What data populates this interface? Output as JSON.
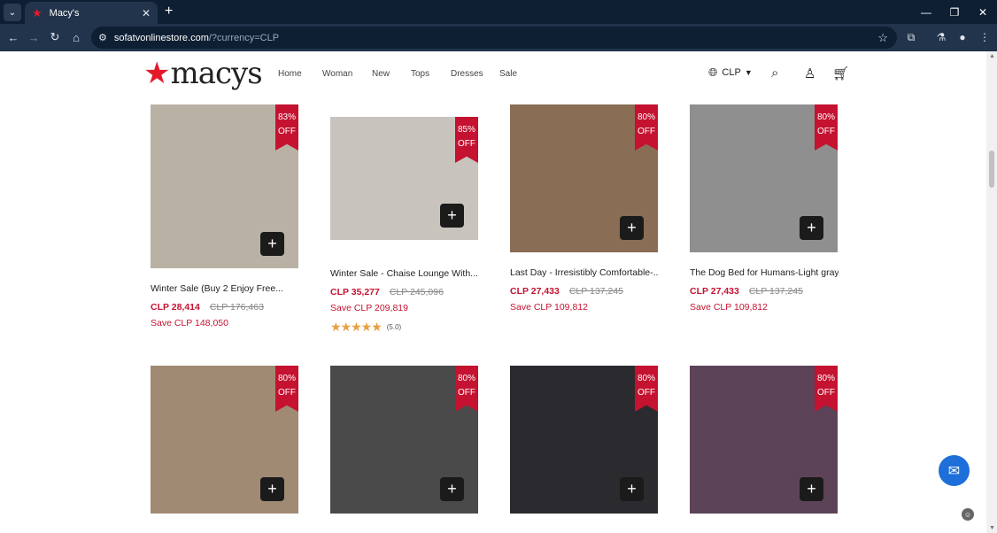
{
  "browser": {
    "tab_title": "Macy's",
    "url_host": "sofatvonlinestore.com",
    "url_path": "/?currency=CLP"
  },
  "header": {
    "logo_text": "macys",
    "nav": [
      "Home",
      "Woman",
      "New",
      "Tops",
      "Dresses",
      "Sale"
    ],
    "currency": "CLP"
  },
  "products": [
    {
      "discount": "83%",
      "off": "OFF",
      "name": "Winter Sale (Buy 2 Enjoy Free...",
      "price": "CLP 28,414",
      "original": "CLP 176,463",
      "save": "Save CLP 148,050",
      "color": "#b9b1a4"
    },
    {
      "discount": "85%",
      "off": "OFF",
      "name": "Winter Sale - Chaise Lounge With...",
      "price": "CLP 35,277",
      "original": "CLP 245,096",
      "save": "Save CLP 209,819",
      "rating": "(5.0)",
      "color": "#c8c4bd"
    },
    {
      "discount": "80%",
      "off": "OFF",
      "name": "Last Day - Irresistibly Comfortable-...",
      "price": "CLP 27,433",
      "original": "CLP 137,245",
      "save": "Save CLP 109,812",
      "color": "#8a6d55"
    },
    {
      "discount": "80%",
      "off": "OFF",
      "name": "The Dog Bed for Humans-Light gray",
      "price": "CLP 27,433",
      "original": "CLP 137,245",
      "save": "Save CLP 109,812",
      "color": "#8f8f8f"
    },
    {
      "discount": "80%",
      "off": "OFF",
      "color": "#a08a73"
    },
    {
      "discount": "80%",
      "off": "OFF",
      "color": "#4a4a4a"
    },
    {
      "discount": "80%",
      "off": "OFF",
      "color": "#2a2a2f"
    },
    {
      "discount": "80%",
      "off": "OFF",
      "color": "#5d4358"
    }
  ]
}
